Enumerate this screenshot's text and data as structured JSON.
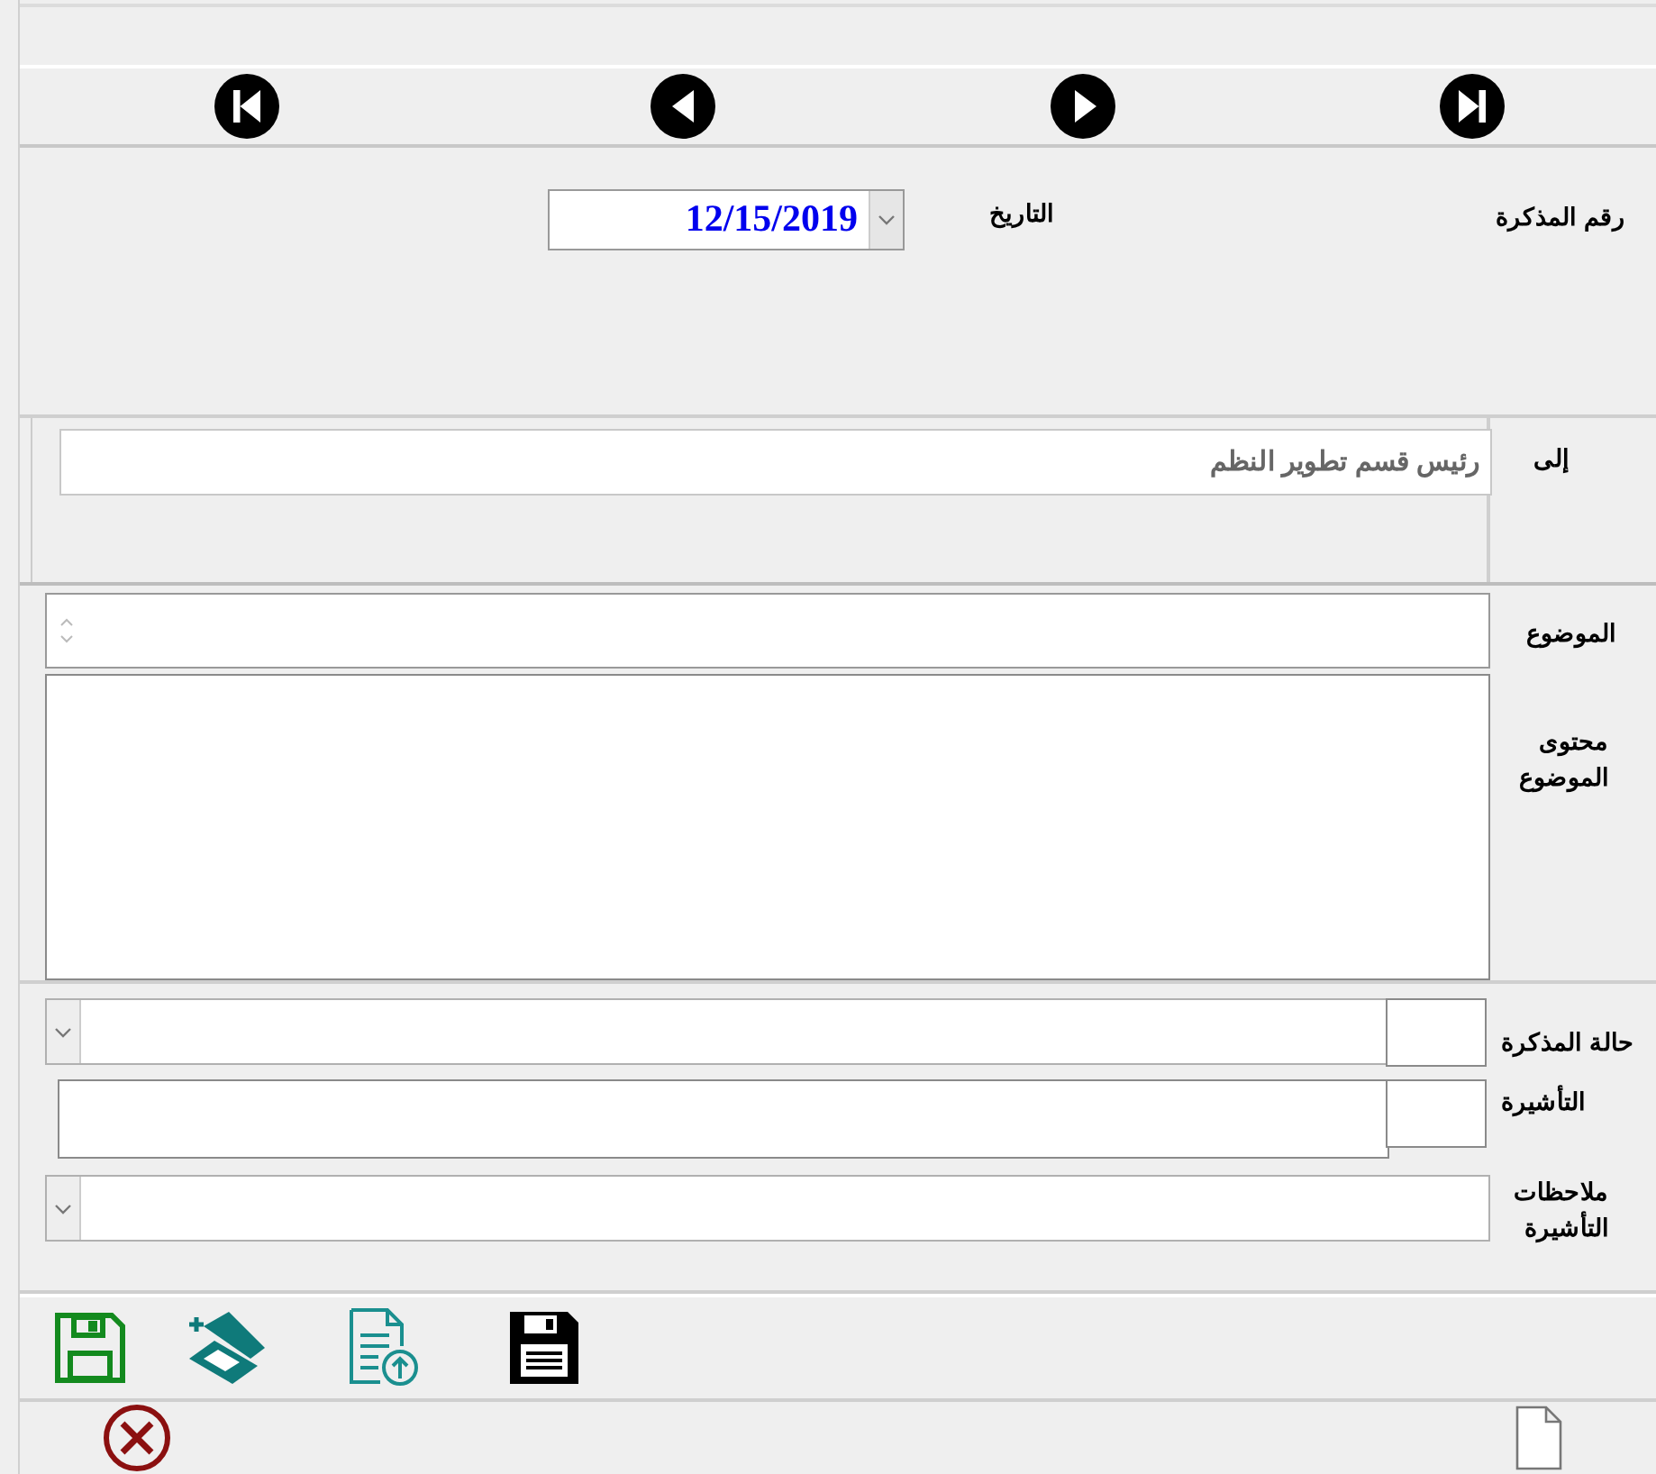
{
  "navigation": {
    "buttons": [
      {
        "kind": "first"
      },
      {
        "kind": "previous"
      },
      {
        "kind": "next"
      },
      {
        "kind": "last"
      }
    ]
  },
  "header": {
    "memo_number_label": "رقم المذكرة",
    "date_label": "التاريخ",
    "date_value": "12/15/2019"
  },
  "recipient": {
    "label": "إلى",
    "value": "رئيس قسم تطوير النظم"
  },
  "subject": {
    "label": "الموضوع"
  },
  "content": {
    "label": "محتوى الموضوع"
  },
  "memo_status": {
    "label": "حالة المذكرة"
  },
  "endorsement": {
    "label": "التأشيرة"
  },
  "endorsement_notes": {
    "label": "ملاحظات التأشيرة"
  },
  "toolbar": {
    "buttons": [
      {
        "kind": "save"
      },
      {
        "kind": "scan"
      },
      {
        "kind": "upload"
      },
      {
        "kind": "save-dark"
      }
    ]
  },
  "footer": {
    "buttons": [
      {
        "kind": "cancel"
      },
      {
        "kind": "document"
      }
    ]
  }
}
